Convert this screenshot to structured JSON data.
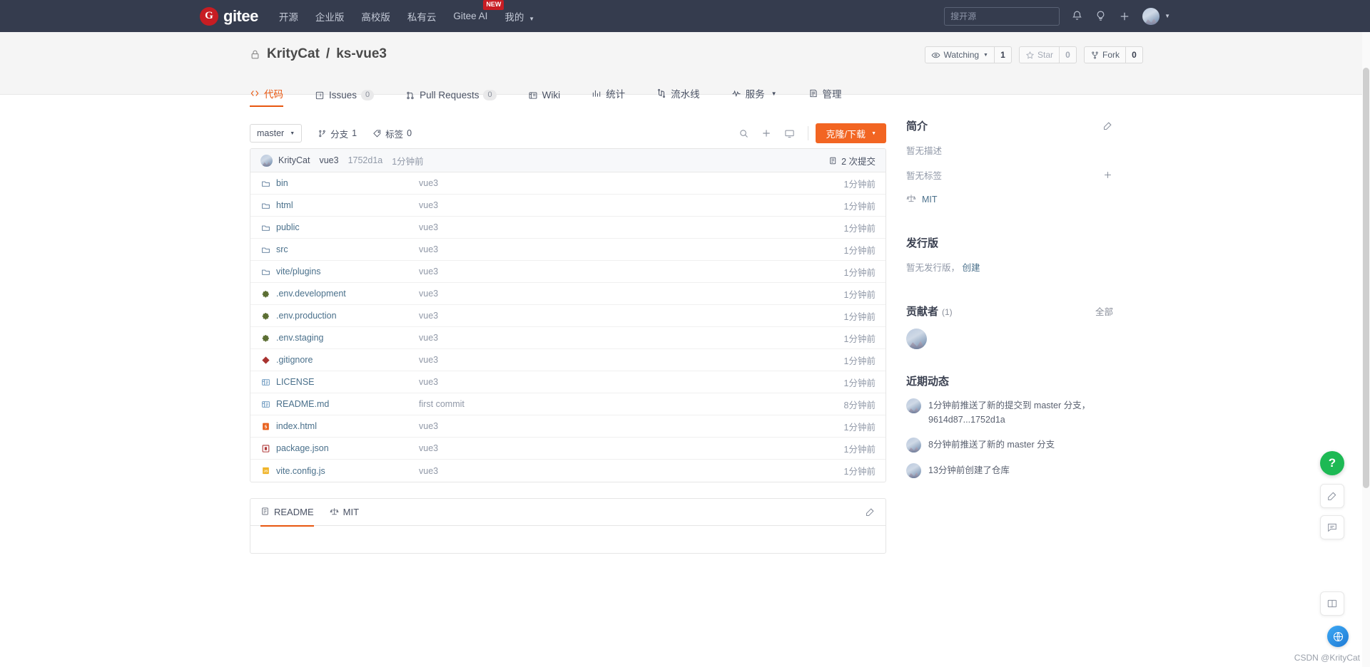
{
  "topnav": {
    "logo_letter": "G",
    "logo_text": "gitee",
    "links": [
      {
        "label": "开源",
        "name": "nav-opensource"
      },
      {
        "label": "企业版",
        "name": "nav-enterprise"
      },
      {
        "label": "高校版",
        "name": "nav-education"
      },
      {
        "label": "私有云",
        "name": "nav-private-cloud"
      },
      {
        "label": "Gitee AI",
        "name": "nav-gitee-ai",
        "badge": "NEW"
      },
      {
        "label": "我的",
        "name": "nav-mine",
        "caret": true
      }
    ],
    "search_placeholder": "搜开源",
    "search_value": "",
    "icons": [
      "bell-icon",
      "lightbulb-icon",
      "plus-icon",
      "avatar"
    ]
  },
  "repo": {
    "owner": "KrityCat",
    "separator": "/",
    "name": "ks-vue3",
    "visibility_icon": "lock-icon",
    "watch_label": "Watching",
    "watch_count": "1",
    "star_label": "Star",
    "star_count": "0",
    "fork_label": "Fork",
    "fork_count": "0"
  },
  "tabs": [
    {
      "label": "代码",
      "icon": "code-icon",
      "count": null,
      "active": true,
      "name": "tab-code"
    },
    {
      "label": "Issues",
      "icon": "issue-icon",
      "count": "0",
      "active": false,
      "name": "tab-issues"
    },
    {
      "label": "Pull Requests",
      "icon": "pr-icon",
      "count": "0",
      "active": false,
      "name": "tab-pull-requests"
    },
    {
      "label": "Wiki",
      "icon": "wiki-icon",
      "count": null,
      "active": false,
      "name": "tab-wiki"
    },
    {
      "label": "统计",
      "icon": "stats-icon",
      "count": null,
      "active": false,
      "name": "tab-stats"
    },
    {
      "label": "流水线",
      "icon": "pipeline-icon",
      "count": null,
      "active": false,
      "name": "tab-pipeline"
    },
    {
      "label": "服务",
      "icon": "service-icon",
      "count": null,
      "active": false,
      "caret": true,
      "name": "tab-service"
    },
    {
      "label": "管理",
      "icon": "manage-icon",
      "count": null,
      "active": false,
      "name": "tab-manage"
    }
  ],
  "toolbar": {
    "branch": "master",
    "branches_label": "分支",
    "branches_count": "1",
    "tags_label": "标签",
    "tags_count": "0",
    "clone_label": "克隆/下载"
  },
  "commit_bar": {
    "author": "KrityCat",
    "message": "vue3",
    "sha": "1752d1a",
    "time": "1分钟前",
    "commits_label": "2 次提交"
  },
  "files": [
    {
      "name": "bin",
      "icon": "folder-icon",
      "commit": "vue3",
      "time": "1分钟前"
    },
    {
      "name": "html",
      "icon": "folder-icon",
      "commit": "vue3",
      "time": "1分钟前"
    },
    {
      "name": "public",
      "icon": "folder-icon",
      "commit": "vue3",
      "time": "1分钟前"
    },
    {
      "name": "src",
      "icon": "folder-icon",
      "commit": "vue3",
      "time": "1分钟前"
    },
    {
      "name": "vite/plugins",
      "icon": "folder-icon",
      "commit": "vue3",
      "time": "1分钟前"
    },
    {
      "name": ".env.development",
      "icon": "gear-file-icon",
      "commit": "vue3",
      "time": "1分钟前"
    },
    {
      "name": ".env.production",
      "icon": "gear-file-icon",
      "commit": "vue3",
      "time": "1分钟前"
    },
    {
      "name": ".env.staging",
      "icon": "gear-file-icon",
      "commit": "vue3",
      "time": "1分钟前"
    },
    {
      "name": ".gitignore",
      "icon": "git-file-icon",
      "commit": "vue3",
      "time": "1分钟前"
    },
    {
      "name": "LICENSE",
      "icon": "text-file-icon",
      "commit": "vue3",
      "time": "1分钟前"
    },
    {
      "name": "README.md",
      "icon": "text-file-icon",
      "commit": "first commit",
      "time": "8分钟前"
    },
    {
      "name": "index.html",
      "icon": "html5-file-icon",
      "commit": "vue3",
      "time": "1分钟前"
    },
    {
      "name": "package.json",
      "icon": "json-file-icon",
      "commit": "vue3",
      "time": "1分钟前"
    },
    {
      "name": "vite.config.js",
      "icon": "js-file-icon",
      "commit": "vue3",
      "time": "1分钟前"
    }
  ],
  "readme_panel": {
    "tabs": [
      {
        "label": "README",
        "icon": "readme-icon",
        "active": true,
        "name": "readme-tab"
      },
      {
        "label": "MIT",
        "icon": "license-icon",
        "active": false,
        "name": "license-tab"
      }
    ],
    "edit_icon": "edit-icon"
  },
  "sidebar": {
    "about": {
      "title": "简介",
      "edit_icon": "edit-icon",
      "description": "暂无描述",
      "tags_empty": "暂无标签",
      "add_tag_icon": "plus-icon",
      "license_icon": "scale-icon",
      "license": "MIT"
    },
    "releases": {
      "title": "发行版",
      "empty_text": "暂无发行版，",
      "create_link": "创建"
    },
    "contributors": {
      "title": "贡献者",
      "count": "(1)",
      "all_label": "全部",
      "avatars": [
        "KrityCat"
      ]
    },
    "activity": {
      "title": "近期动态",
      "items": [
        {
          "text": "1分钟前推送了新的提交到 master 分支，9614d87...1752d1a",
          "link": "master"
        },
        {
          "text": "8分钟前推送了新的 master 分支",
          "link": "master"
        },
        {
          "text": "13分钟前创建了仓库",
          "link": ""
        }
      ]
    }
  },
  "floating": {
    "help": "?",
    "edit_icon": "edit-square-icon",
    "chat_icon": "chat-icon",
    "book_icon": "book-icon",
    "globe_icon": "globe-icon"
  },
  "watermark": "CSDN @KrityCat",
  "colors": {
    "nav_bg": "#353c4e",
    "brand_red": "#c71d23",
    "accent_orange": "#e8560f",
    "clone_orange": "#f26522",
    "link_blue": "#4a708b",
    "muted": "#9199a8"
  }
}
